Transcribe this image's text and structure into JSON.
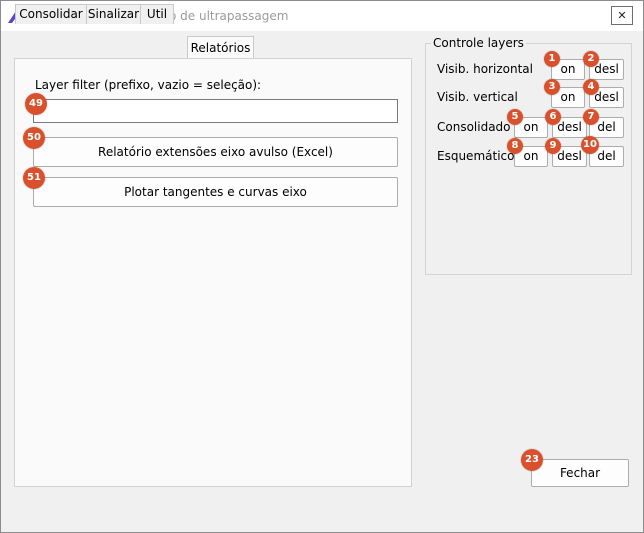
{
  "window": {
    "title": "Consolidado — proibição de ultrapassagem",
    "close_glyph": "✕",
    "accent_color": "#5b43d6"
  },
  "tabs": [
    {
      "label": "Consolidar",
      "active": false
    },
    {
      "label": "Sinalizar",
      "active": false
    },
    {
      "label": "Util",
      "active": false
    },
    {
      "label": "Relatórios",
      "active": true
    }
  ],
  "reports": {
    "layer_filter_label": "Layer filter (prefixo, vazio = seleção):",
    "layer_filter_value": "",
    "btn_report_excel": "Relatório extensões eixo avulso (Excel)",
    "btn_plot": "Plotar tangentes e curvas eixo"
  },
  "layers": {
    "title": "Controle layers",
    "rows": [
      {
        "label": "Visib. horizontal",
        "on": "on",
        "off": "desl"
      },
      {
        "label": "Visib. vertical",
        "on": "on",
        "off": "desl"
      },
      {
        "label": "Consolidado",
        "on": "on",
        "off": "desl",
        "del": "del"
      },
      {
        "label": "Esquemático",
        "on": "on",
        "off": "desl",
        "del": "del"
      }
    ]
  },
  "footer": {
    "close_label": "Fechar"
  },
  "badges": {
    "b1": "1",
    "b2": "2",
    "b3": "3",
    "b4": "4",
    "b5": "5",
    "b6": "6",
    "b7": "7",
    "b8": "8",
    "b9": "9",
    "b10": "10",
    "b23": "23",
    "b49": "49",
    "b50": "50",
    "b51": "51",
    "color": "#d9512c"
  }
}
